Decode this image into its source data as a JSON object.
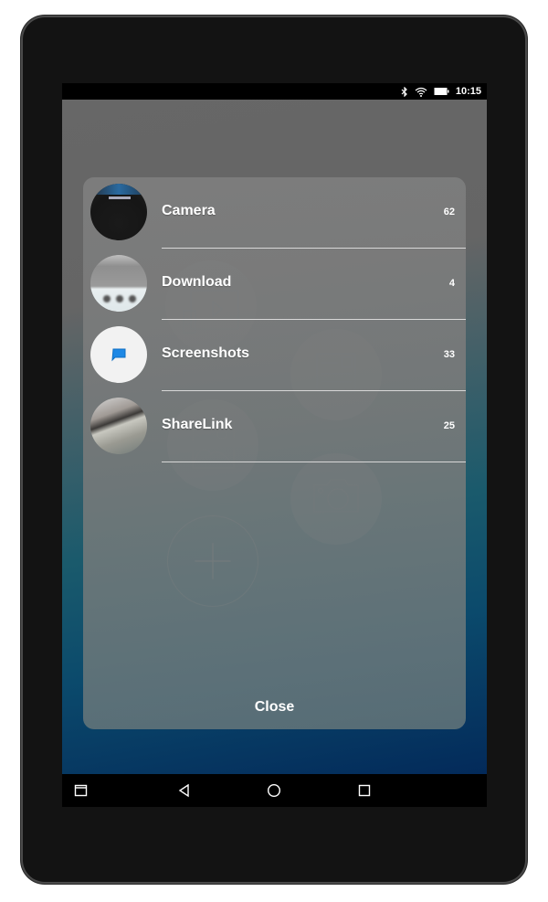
{
  "status_bar": {
    "icons": [
      "bluetooth-icon",
      "wifi-icon",
      "battery-icon"
    ],
    "time": "10:15"
  },
  "background": {
    "bubbles": [
      "video-icon",
      "news-icon",
      "image-icon",
      "camera-icon",
      "add-icon"
    ]
  },
  "album_picker": {
    "albums": [
      {
        "name": "Camera",
        "count": "62",
        "thumb": "dark-photo"
      },
      {
        "name": "Download",
        "count": "4",
        "thumb": "keyboard-photo"
      },
      {
        "name": "Screenshots",
        "count": "33",
        "thumb": "screenshot-icon"
      },
      {
        "name": "ShareLink",
        "count": "25",
        "thumb": "outdoor-photo"
      }
    ],
    "close_label": "Close"
  },
  "nav_bar": {
    "buttons": [
      "app-switcher",
      "back",
      "home",
      "recents"
    ]
  },
  "colors": {
    "accent_blue": "#1e88e5",
    "wallpaper_bottom": "#032a5a",
    "wallpaper_mid": "#0b4a6c"
  }
}
